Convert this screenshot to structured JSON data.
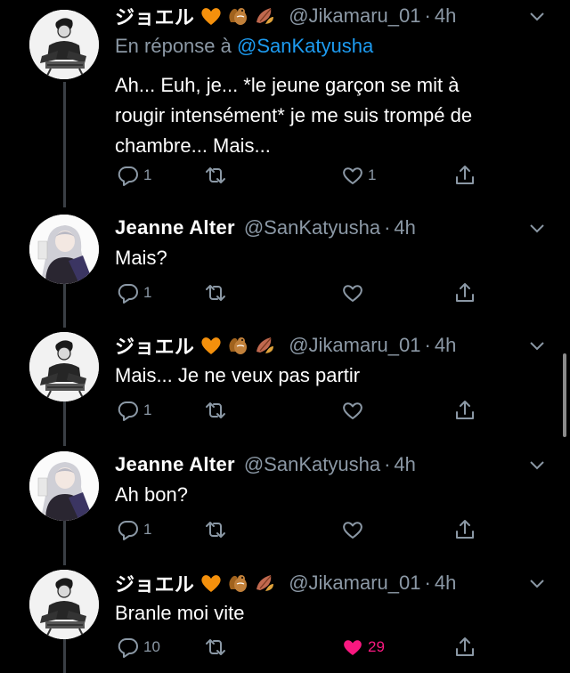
{
  "tweets": [
    {
      "name": "ジョエル",
      "has_emojis": true,
      "handle": "@Jikamaru_01",
      "time": "4h",
      "reply_prefix": "En réponse à ",
      "reply_mention": "@SanKatyusha",
      "text_lines": [
        "Ah... Euh, je... *le jeune garçon se mit à",
        "rougir intensément* je me suis trompé de",
        "chambre... Mais..."
      ],
      "replies": "1",
      "retweets": "",
      "likes": "1",
      "liked": false
    },
    {
      "name": "Jeanne Alter",
      "handle": "@SanKatyusha",
      "time": "4h",
      "text_lines": [
        "Mais?"
      ],
      "replies": "1",
      "retweets": "",
      "likes": "",
      "liked": false
    },
    {
      "name": "ジョエル",
      "has_emojis": true,
      "handle": "@Jikamaru_01",
      "time": "4h",
      "text_lines": [
        "Mais... Je ne veux pas partir"
      ],
      "replies": "1",
      "retweets": "",
      "likes": "",
      "liked": false
    },
    {
      "name": "Jeanne Alter",
      "handle": "@SanKatyusha",
      "time": "4h",
      "text_lines": [
        "Ah bon?"
      ],
      "replies": "1",
      "retweets": "",
      "likes": "",
      "liked": false
    },
    {
      "name": "ジョエル",
      "has_emojis": true,
      "handle": "@Jikamaru_01",
      "time": "4h",
      "text_lines": [
        "Branle moi vite"
      ],
      "replies": "10",
      "retweets": "",
      "likes": "29",
      "liked": true
    }
  ],
  "dot_separator": "·",
  "emoji_names": [
    "orange-heart-icon",
    "chipmunk-icon",
    "fallen-leaf-icon"
  ],
  "colors": {
    "background": "#000000",
    "text": "#ffffff",
    "muted": "#8b98a5",
    "link": "#1d9bf0",
    "like": "#f91880",
    "thread_line": "#3a3f45"
  }
}
